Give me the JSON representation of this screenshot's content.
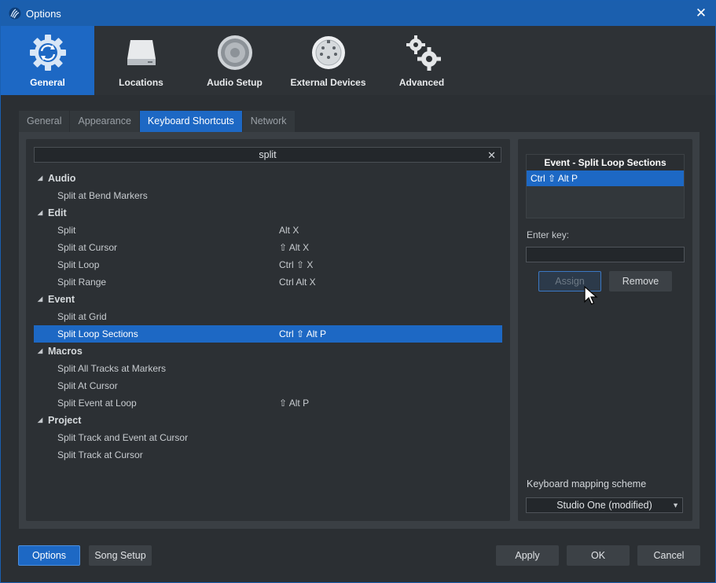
{
  "window": {
    "title": "Options"
  },
  "categories": [
    {
      "label": "General",
      "icon": "gear-refresh-icon",
      "active": true
    },
    {
      "label": "Locations",
      "icon": "drive-icon",
      "active": false
    },
    {
      "label": "Audio Setup",
      "icon": "speaker-icon",
      "active": false
    },
    {
      "label": "External Devices",
      "icon": "midi-port-icon",
      "active": false
    },
    {
      "label": "Advanced",
      "icon": "gears-icon",
      "active": false
    }
  ],
  "tabs": [
    {
      "label": "General"
    },
    {
      "label": "Appearance"
    },
    {
      "label": "Keyboard Shortcuts"
    },
    {
      "label": "Network"
    }
  ],
  "search": {
    "value": "split",
    "clear_glyph": "✕"
  },
  "groups": [
    {
      "name": "Audio",
      "items": [
        {
          "label": "Split at Bend Markers",
          "shortcut": ""
        }
      ]
    },
    {
      "name": "Edit",
      "items": [
        {
          "label": "Split",
          "shortcut": "Alt X"
        },
        {
          "label": "Split at Cursor",
          "shortcut": "⇧ Alt X"
        },
        {
          "label": "Split Loop",
          "shortcut": "Ctrl ⇧ X"
        },
        {
          "label": "Split Range",
          "shortcut": "Ctrl Alt X"
        }
      ]
    },
    {
      "name": "Event",
      "items": [
        {
          "label": "Split at Grid",
          "shortcut": ""
        },
        {
          "label": "Split Loop Sections",
          "shortcut": "Ctrl ⇧ Alt P",
          "selected": true
        }
      ]
    },
    {
      "name": "Macros",
      "items": [
        {
          "label": "Split All Tracks at Markers",
          "shortcut": ""
        },
        {
          "label": "Split At Cursor",
          "shortcut": ""
        },
        {
          "label": "Split Event at Loop",
          "shortcut": "⇧ Alt P"
        }
      ]
    },
    {
      "name": "Project",
      "items": [
        {
          "label": "Split Track and Event at Cursor",
          "shortcut": ""
        },
        {
          "label": "Split Track at Cursor",
          "shortcut": ""
        }
      ]
    }
  ],
  "detail": {
    "header": "Event - Split Loop Sections",
    "assigned_key": "Ctrl ⇧ Alt P",
    "enter_key_label": "Enter key:",
    "enter_key_value": "",
    "assign_label": "Assign",
    "remove_label": "Remove",
    "scheme_label": "Keyboard mapping scheme",
    "scheme_value": "Studio One (modified)"
  },
  "footer": {
    "options_label": "Options",
    "song_setup_label": "Song Setup",
    "apply_label": "Apply",
    "ok_label": "OK",
    "cancel_label": "Cancel"
  },
  "colors": {
    "accent": "#1d68c4",
    "titlebar": "#1b5fae",
    "panel": "#2c3034"
  }
}
